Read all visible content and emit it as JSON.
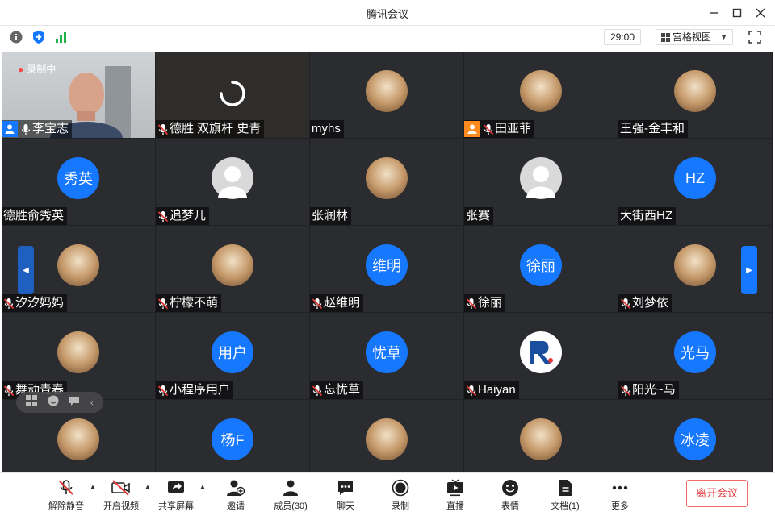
{
  "window": {
    "title": "腾讯会议"
  },
  "toolbar": {
    "timer": "29:00",
    "view_label": "宫格视图"
  },
  "colors": {
    "accent": "#1677ff",
    "leave": "#e64545",
    "dark_bg": "#202124"
  },
  "recording_label": "录制中",
  "tiles": [
    {
      "name": "李宝志",
      "mic": "on",
      "badge": "blue",
      "avatar": "video"
    },
    {
      "name": "德胜 双旗杆 史青",
      "mic": "off",
      "avatar": "loading"
    },
    {
      "name": "myhs",
      "mic": "none",
      "avatar": "photo"
    },
    {
      "name": "田亚菲",
      "mic": "off",
      "badge": "orange",
      "avatar": "photo"
    },
    {
      "name": "王强-金丰和",
      "mic": "none",
      "avatar": "photo"
    },
    {
      "name": "德胜俞秀英",
      "mic": "none",
      "avatar": "text",
      "avatar_text": "秀英"
    },
    {
      "name": "追梦儿",
      "mic": "off",
      "avatar": "gray"
    },
    {
      "name": "张润林",
      "mic": "none",
      "avatar": "photo"
    },
    {
      "name": "张赛",
      "mic": "none",
      "avatar": "gray"
    },
    {
      "name": "大街西HZ",
      "mic": "none",
      "avatar": "text",
      "avatar_text": "HZ"
    },
    {
      "name": "汐汐妈妈",
      "mic": "off",
      "avatar": "photo"
    },
    {
      "name": "柠檬不萌",
      "mic": "off",
      "avatar": "photo"
    },
    {
      "name": "赵维明",
      "mic": "off",
      "avatar": "text",
      "avatar_text": "维明"
    },
    {
      "name": "徐丽",
      "mic": "off",
      "avatar": "text",
      "avatar_text": "徐丽"
    },
    {
      "name": "刘梦依",
      "mic": "off",
      "avatar": "photo"
    },
    {
      "name": "舞动青春",
      "mic": "off",
      "avatar": "photo"
    },
    {
      "name": "小程序用户",
      "mic": "off",
      "avatar": "text",
      "avatar_text": "用户"
    },
    {
      "name": "忘忧草",
      "mic": "off",
      "avatar": "text",
      "avatar_text": "忧草"
    },
    {
      "name": "Haiyan",
      "mic": "off",
      "avatar": "logo"
    },
    {
      "name": "阳光~马",
      "mic": "off",
      "avatar": "text",
      "avatar_text": "光马"
    },
    {
      "name": "",
      "mic": "none",
      "avatar": "photo"
    },
    {
      "name": "",
      "mic": "none",
      "avatar": "text",
      "avatar_text": "杨F"
    },
    {
      "name": "",
      "mic": "none",
      "avatar": "photo"
    },
    {
      "name": "",
      "mic": "none",
      "avatar": "photo"
    },
    {
      "name": "",
      "mic": "none",
      "avatar": "text",
      "avatar_text": "冰凌"
    }
  ],
  "bottombar": {
    "unmute": "解除静音",
    "start_video": "开启视频",
    "share_screen": "共享屏幕",
    "invite": "邀请",
    "members": "成员(30)",
    "chat": "聊天",
    "record": "录制",
    "live": "直播",
    "reactions": "表情",
    "docs": "文档(1)",
    "more": "更多",
    "leave": "离开会议"
  }
}
